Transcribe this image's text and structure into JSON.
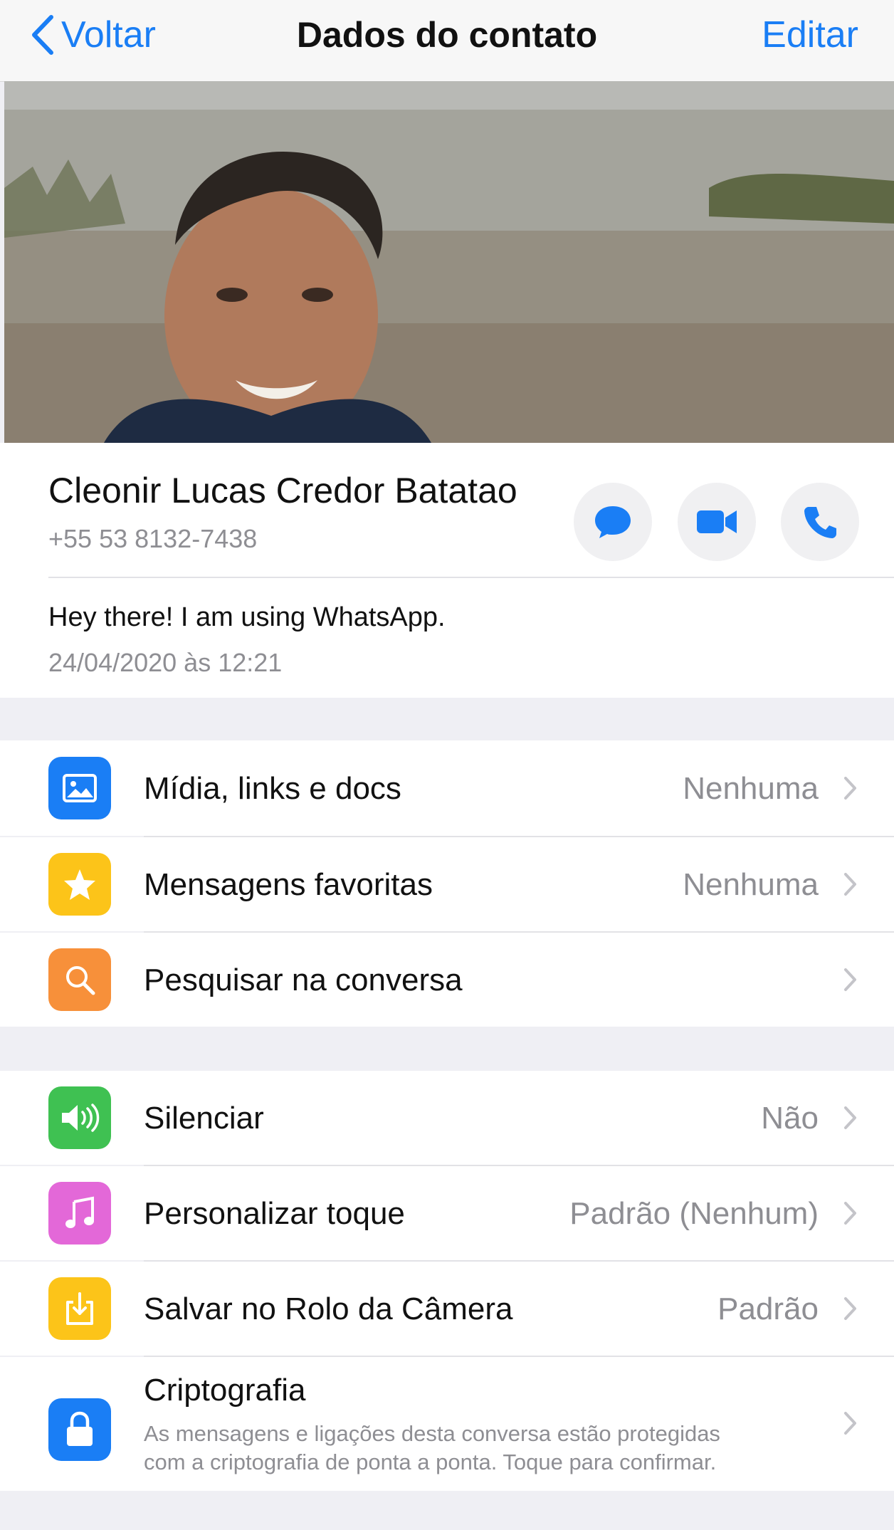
{
  "navbar": {
    "back_label": "Voltar",
    "title": "Dados do contato",
    "edit_label": "Editar"
  },
  "contact": {
    "name": "Cleonir Lucas Credor Batatao",
    "phone": "+55 53 8132-7438",
    "status": "Hey there! I am using WhatsApp.",
    "status_date": "24/04/2020 às 12:21",
    "actions": [
      {
        "icon": "message-icon"
      },
      {
        "icon": "video-call-icon"
      },
      {
        "icon": "phone-call-icon"
      }
    ]
  },
  "section1": [
    {
      "icon": "media-icon",
      "color": "#1a7ef5",
      "label": "Mídia, links e docs",
      "value": "Nenhuma"
    },
    {
      "icon": "star-icon",
      "color": "#fcc419",
      "label": "Mensagens favoritas",
      "value": "Nenhuma"
    },
    {
      "icon": "search-icon",
      "color": "#f7903a",
      "label": "Pesquisar na conversa",
      "value": ""
    }
  ],
  "section2": [
    {
      "icon": "speaker-icon",
      "color": "#3fc152",
      "label": "Silenciar",
      "value": "Não"
    },
    {
      "icon": "music-note-icon",
      "color": "#e368d8",
      "label": "Personalizar toque",
      "value": "Padrão (Nenhum)"
    },
    {
      "icon": "save-download-icon",
      "color": "#fcc419",
      "label": "Salvar no Rolo da Câmera",
      "value": "Padrão"
    },
    {
      "icon": "lock-icon",
      "color": "#1a7ef5",
      "label": "Criptografia",
      "sub_line1": "As mensagens e ligações desta conversa estão protegidas",
      "sub_line2": "com a criptografia de ponta a ponta. Toque para confirmar."
    }
  ],
  "colors": {
    "accent": "#1a7ef5",
    "background": "#efeff4"
  }
}
